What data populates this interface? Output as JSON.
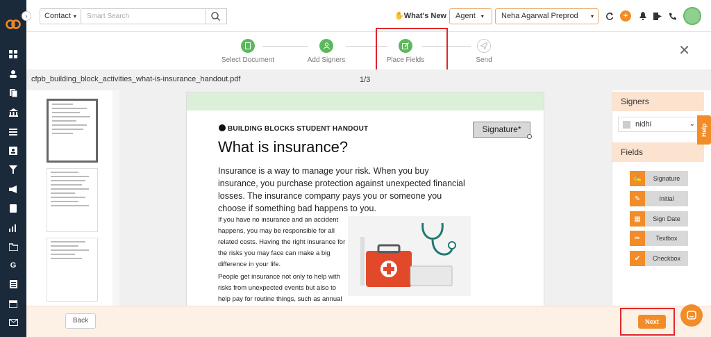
{
  "sidebar": {
    "icons": [
      "dashboard-icon",
      "contacts-icon",
      "documents-icon",
      "bank-icon",
      "list-icon",
      "id-card-icon",
      "filter-icon",
      "megaphone-icon",
      "book-icon",
      "bar-chart-icon",
      "folder-icon",
      "google-icon",
      "spreadsheet-icon",
      "calendar-icon",
      "mail-icon"
    ],
    "google_letter": "G"
  },
  "topbar": {
    "contact_label": "Contact",
    "search_placeholder": "Smart Search",
    "whats_new": "What's New",
    "role_value": "Agent",
    "account_value": "Neha Agarwal Preprod"
  },
  "stepper": {
    "steps": [
      {
        "label": "Select Document",
        "state": "done"
      },
      {
        "label": "Add Signers",
        "state": "done"
      },
      {
        "label": "Place Fields",
        "state": "current"
      },
      {
        "label": "Send",
        "state": "pending"
      }
    ]
  },
  "file": {
    "name": "cfpb_building_block_activities_what-is-insurance_handout.pdf",
    "page_indicator": "1/3"
  },
  "document": {
    "kicker": "BUILDING BLOCKS STUDENT HANDOUT",
    "title": "What is insurance?",
    "intro": "Insurance is a way to manage your risk. When you buy insurance, you purchase protection against unexpected financial losses. The insurance company pays you or someone you choose if something bad happens to you.",
    "para1": "If you have no insurance and an accident happens, you may be responsible for all related costs. Having the right insurance for the risks you may face can make a big difference in your life.",
    "para2": "People get insurance not only to help with risks from unexpected events but also to help pay for routine things, such as annual medical checkups and dental visits. In addition, insurance companies negotiate",
    "placed_field": "Signature*"
  },
  "signers_panel": {
    "title": "Signers",
    "selected_signer": "nidhi"
  },
  "fields_panel": {
    "title": "Fields",
    "items": [
      "Signature",
      "Initial",
      "Sign Date",
      "Textbox",
      "Checkbox"
    ]
  },
  "help_label": "Help",
  "footer": {
    "back_label": "Back",
    "next_label": "Next"
  },
  "colors": {
    "accent": "#f28c28",
    "step_done": "#5cb85c",
    "sidebar_bg": "#1b2a3a",
    "highlight": "#e0262b"
  }
}
